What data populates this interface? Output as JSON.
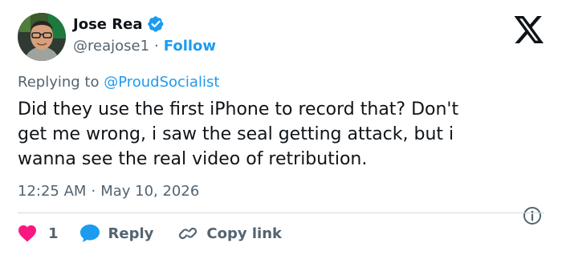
{
  "author": {
    "name": "Jose Rea",
    "handle": "@reajose1",
    "separator": "·",
    "follow_label": "Follow"
  },
  "brand": {
    "icon": "x-logo-icon"
  },
  "reply_context": {
    "prefix": "Replying to ",
    "mention": "@ProudSocialist"
  },
  "tweet": {
    "lines": [
      "Did they use the first iPhone to record that? Don't",
      "get me wrong, i saw the seal getting attack, but i",
      "wanna see the real video of retribution."
    ]
  },
  "meta": {
    "time": "12:25 AM",
    "separator": "·",
    "date": "May 10, 2026"
  },
  "actions": {
    "like_count": "1",
    "reply_label": "Reply",
    "copy_label": "Copy link"
  },
  "colors": {
    "accent": "#1d9bf0",
    "text": "#0f1419",
    "muted": "#536471",
    "like": "#f91880",
    "divider": "#cfd9de"
  }
}
